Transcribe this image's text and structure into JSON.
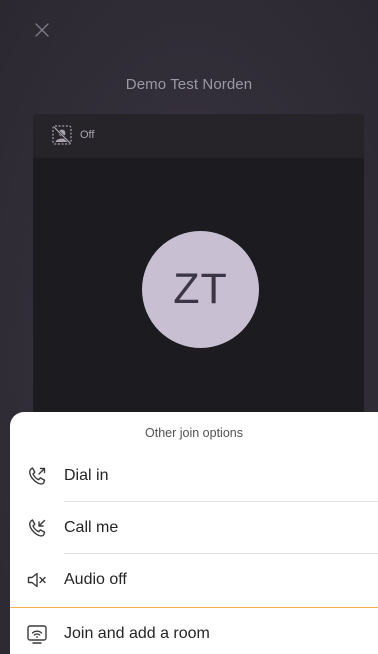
{
  "meeting": {
    "title": "Demo Test Norden"
  },
  "preview": {
    "video_status": "Off",
    "avatar_initials": "ZT"
  },
  "join_sheet": {
    "title": "Other join options",
    "options": [
      {
        "label": "Dial in",
        "icon": "phone-outgoing-icon"
      },
      {
        "label": "Call me",
        "icon": "phone-incoming-icon"
      },
      {
        "label": "Audio off",
        "icon": "speaker-muted-icon"
      },
      {
        "label": "Join and add a room",
        "icon": "room-cast-icon"
      }
    ]
  },
  "colors": {
    "background": "#2e2b34",
    "avatar_bg": "#c8c0d2",
    "focus_accent": "#f5b14a"
  }
}
